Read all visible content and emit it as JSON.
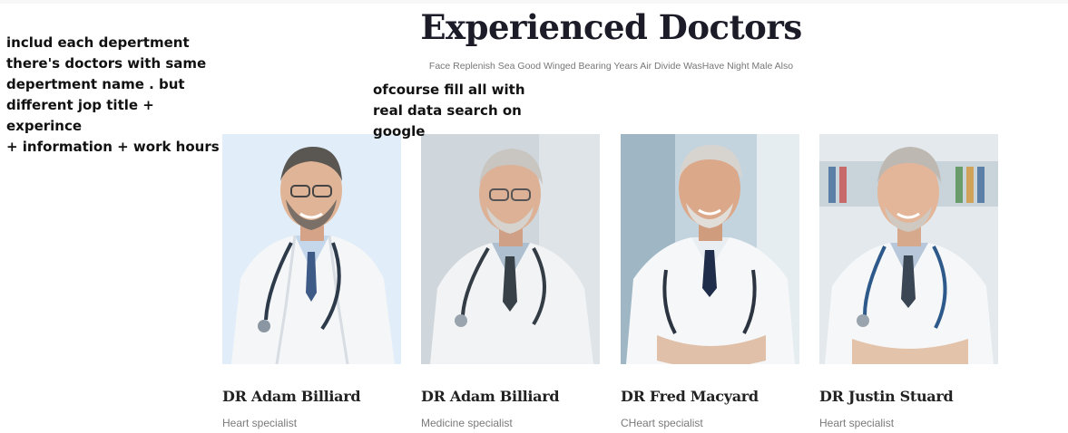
{
  "section": {
    "title": "Experienced Doctors",
    "subtitle": "Face Replenish Sea Good Winged Bearing Years Air Divide WasHave Night Male Also"
  },
  "annotations": {
    "left": "includ each depertment\nthere's doctors with same\ndepertment name . but\ndifferent jop title + experince\n+ information + work hours",
    "right": "ofcourse fill all with\nreal data search on\ngoogle"
  },
  "doctors": [
    {
      "name": "DR Adam Billiard",
      "role": "Heart specialist"
    },
    {
      "name": "DR Adam Billiard",
      "role": "Medicine specialist"
    },
    {
      "name": "DR Fred Macyard",
      "role": "CHeart specialist"
    },
    {
      "name": "DR Justin Stuard",
      "role": "Heart specialist"
    }
  ],
  "colors": {
    "title": "#1c1c28",
    "subtitle": "#777777",
    "name": "#222222",
    "role": "#7a7a7a"
  }
}
